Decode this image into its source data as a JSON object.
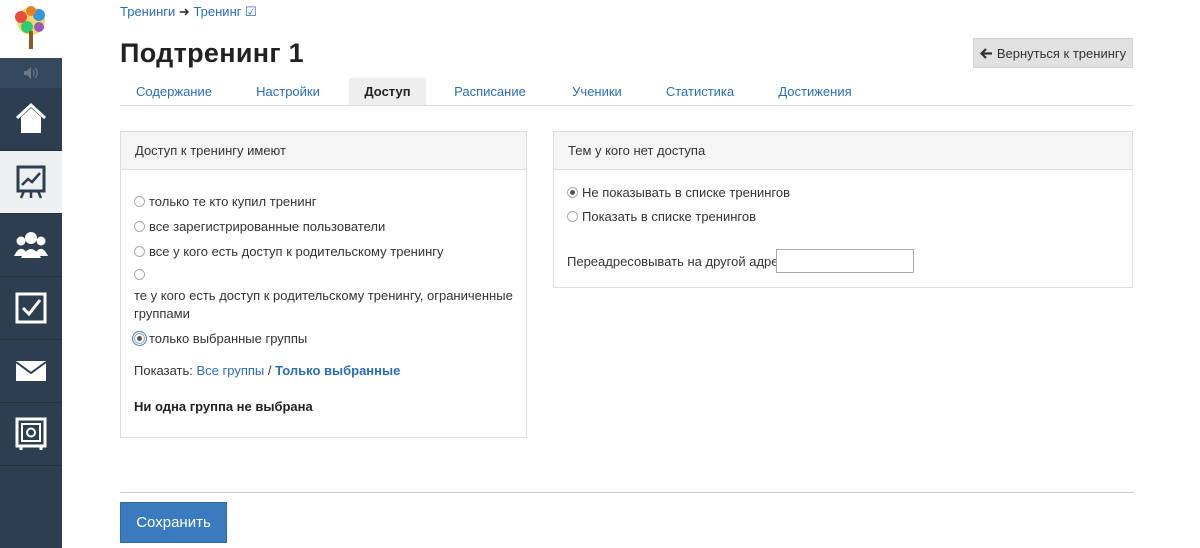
{
  "breadcrumb": {
    "item1": "Тренинги",
    "separator": "➜",
    "item2": "Тренинг ☑"
  },
  "page": {
    "title": "Подтренинг 1"
  },
  "actions": {
    "back_label": "Вернуться к тренингу",
    "back_icon": "arrow-left-icon"
  },
  "tabs": [
    {
      "label": "Содержание"
    },
    {
      "label": "Настройки"
    },
    {
      "label": "Доступ",
      "active": true
    },
    {
      "label": "Расписание"
    },
    {
      "label": "Ученики"
    },
    {
      "label": "Статистика"
    },
    {
      "label": "Достижения"
    }
  ],
  "access_panel": {
    "title": "Доступ к тренингу имеют",
    "options": [
      {
        "label": "только те кто купил тренинг",
        "selected": false
      },
      {
        "label": "все зарегистрированные пользователи",
        "selected": false
      },
      {
        "label": "все у кого есть доступ к родительскому тренингу",
        "selected": false
      },
      {
        "label": "те у кого есть доступ к родительскому тренингу, ограниченные группами",
        "selected": false
      },
      {
        "label": "только выбранные группы",
        "selected": true
      }
    ],
    "show_label": "Показать:",
    "show_all": "Все группы",
    "show_sep": "/",
    "show_selected": "Только выбранные",
    "empty_message": "Ни одна группа не выбрана"
  },
  "no_access_panel": {
    "title": "Тем у кого нет доступа",
    "options": [
      {
        "label": "Не показывать в списке тренингов",
        "selected": true
      },
      {
        "label": "Показать в списке тренингов",
        "selected": false
      }
    ],
    "redirect_label": "Переадресовывать на другой адрес",
    "redirect_value": ""
  },
  "footer": {
    "save_label": "Сохранить"
  },
  "sidebar": {
    "items": [
      {
        "icon": "home-icon"
      },
      {
        "icon": "chart-icon",
        "active": true
      },
      {
        "icon": "users-icon"
      },
      {
        "icon": "checkbox-icon"
      },
      {
        "icon": "mail-icon"
      },
      {
        "icon": "safe-icon"
      }
    ]
  },
  "colors": {
    "sidebar": "#2c3e50",
    "link": "#2a6ebb",
    "primary_button": "#3a7bbf"
  }
}
